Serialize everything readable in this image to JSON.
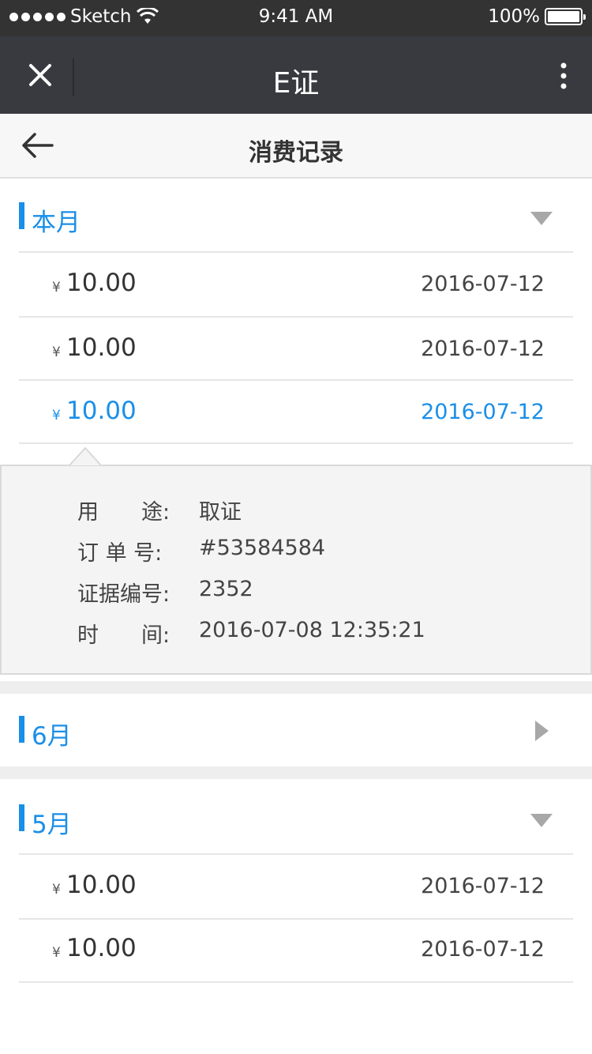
{
  "status_bar": {
    "carrier": "Sketch",
    "time": "9:41 AM",
    "battery": "100%"
  },
  "nav": {
    "title": "E证"
  },
  "sub_header": {
    "title": "消费记录"
  },
  "sections": {
    "this_month": {
      "label": "本月",
      "rows": [
        {
          "currency": "¥",
          "amount": "10.00",
          "date": "2016-07-12"
        },
        {
          "currency": "¥",
          "amount": "10.00",
          "date": "2016-07-12"
        },
        {
          "currency": "¥",
          "amount": "10.00",
          "date": "2016-07-12"
        }
      ],
      "detail": {
        "purpose_label": "用　　途:",
        "purpose_value": "取证",
        "order_label": "订 单 号:",
        "order_value": "#53584584",
        "evidence_label": "证据编号:",
        "evidence_value": "2352",
        "time_label": "时　　间:",
        "time_value": "2016-07-08  12:35:21"
      }
    },
    "june": {
      "label": "6月"
    },
    "may": {
      "label": "5月",
      "rows": [
        {
          "currency": "¥",
          "amount": "10.00",
          "date": "2016-07-12"
        },
        {
          "currency": "¥",
          "amount": "10.00",
          "date": "2016-07-12"
        }
      ]
    }
  },
  "colors": {
    "accent": "#1a8fe8",
    "nav_bg": "#393a3f",
    "status_bg": "#333333"
  },
  "icons": [
    "close-icon",
    "more-icon",
    "back-arrow-icon",
    "collapse-triangle-icon",
    "expand-triangle-icon",
    "wifi-icon",
    "battery-icon"
  ]
}
